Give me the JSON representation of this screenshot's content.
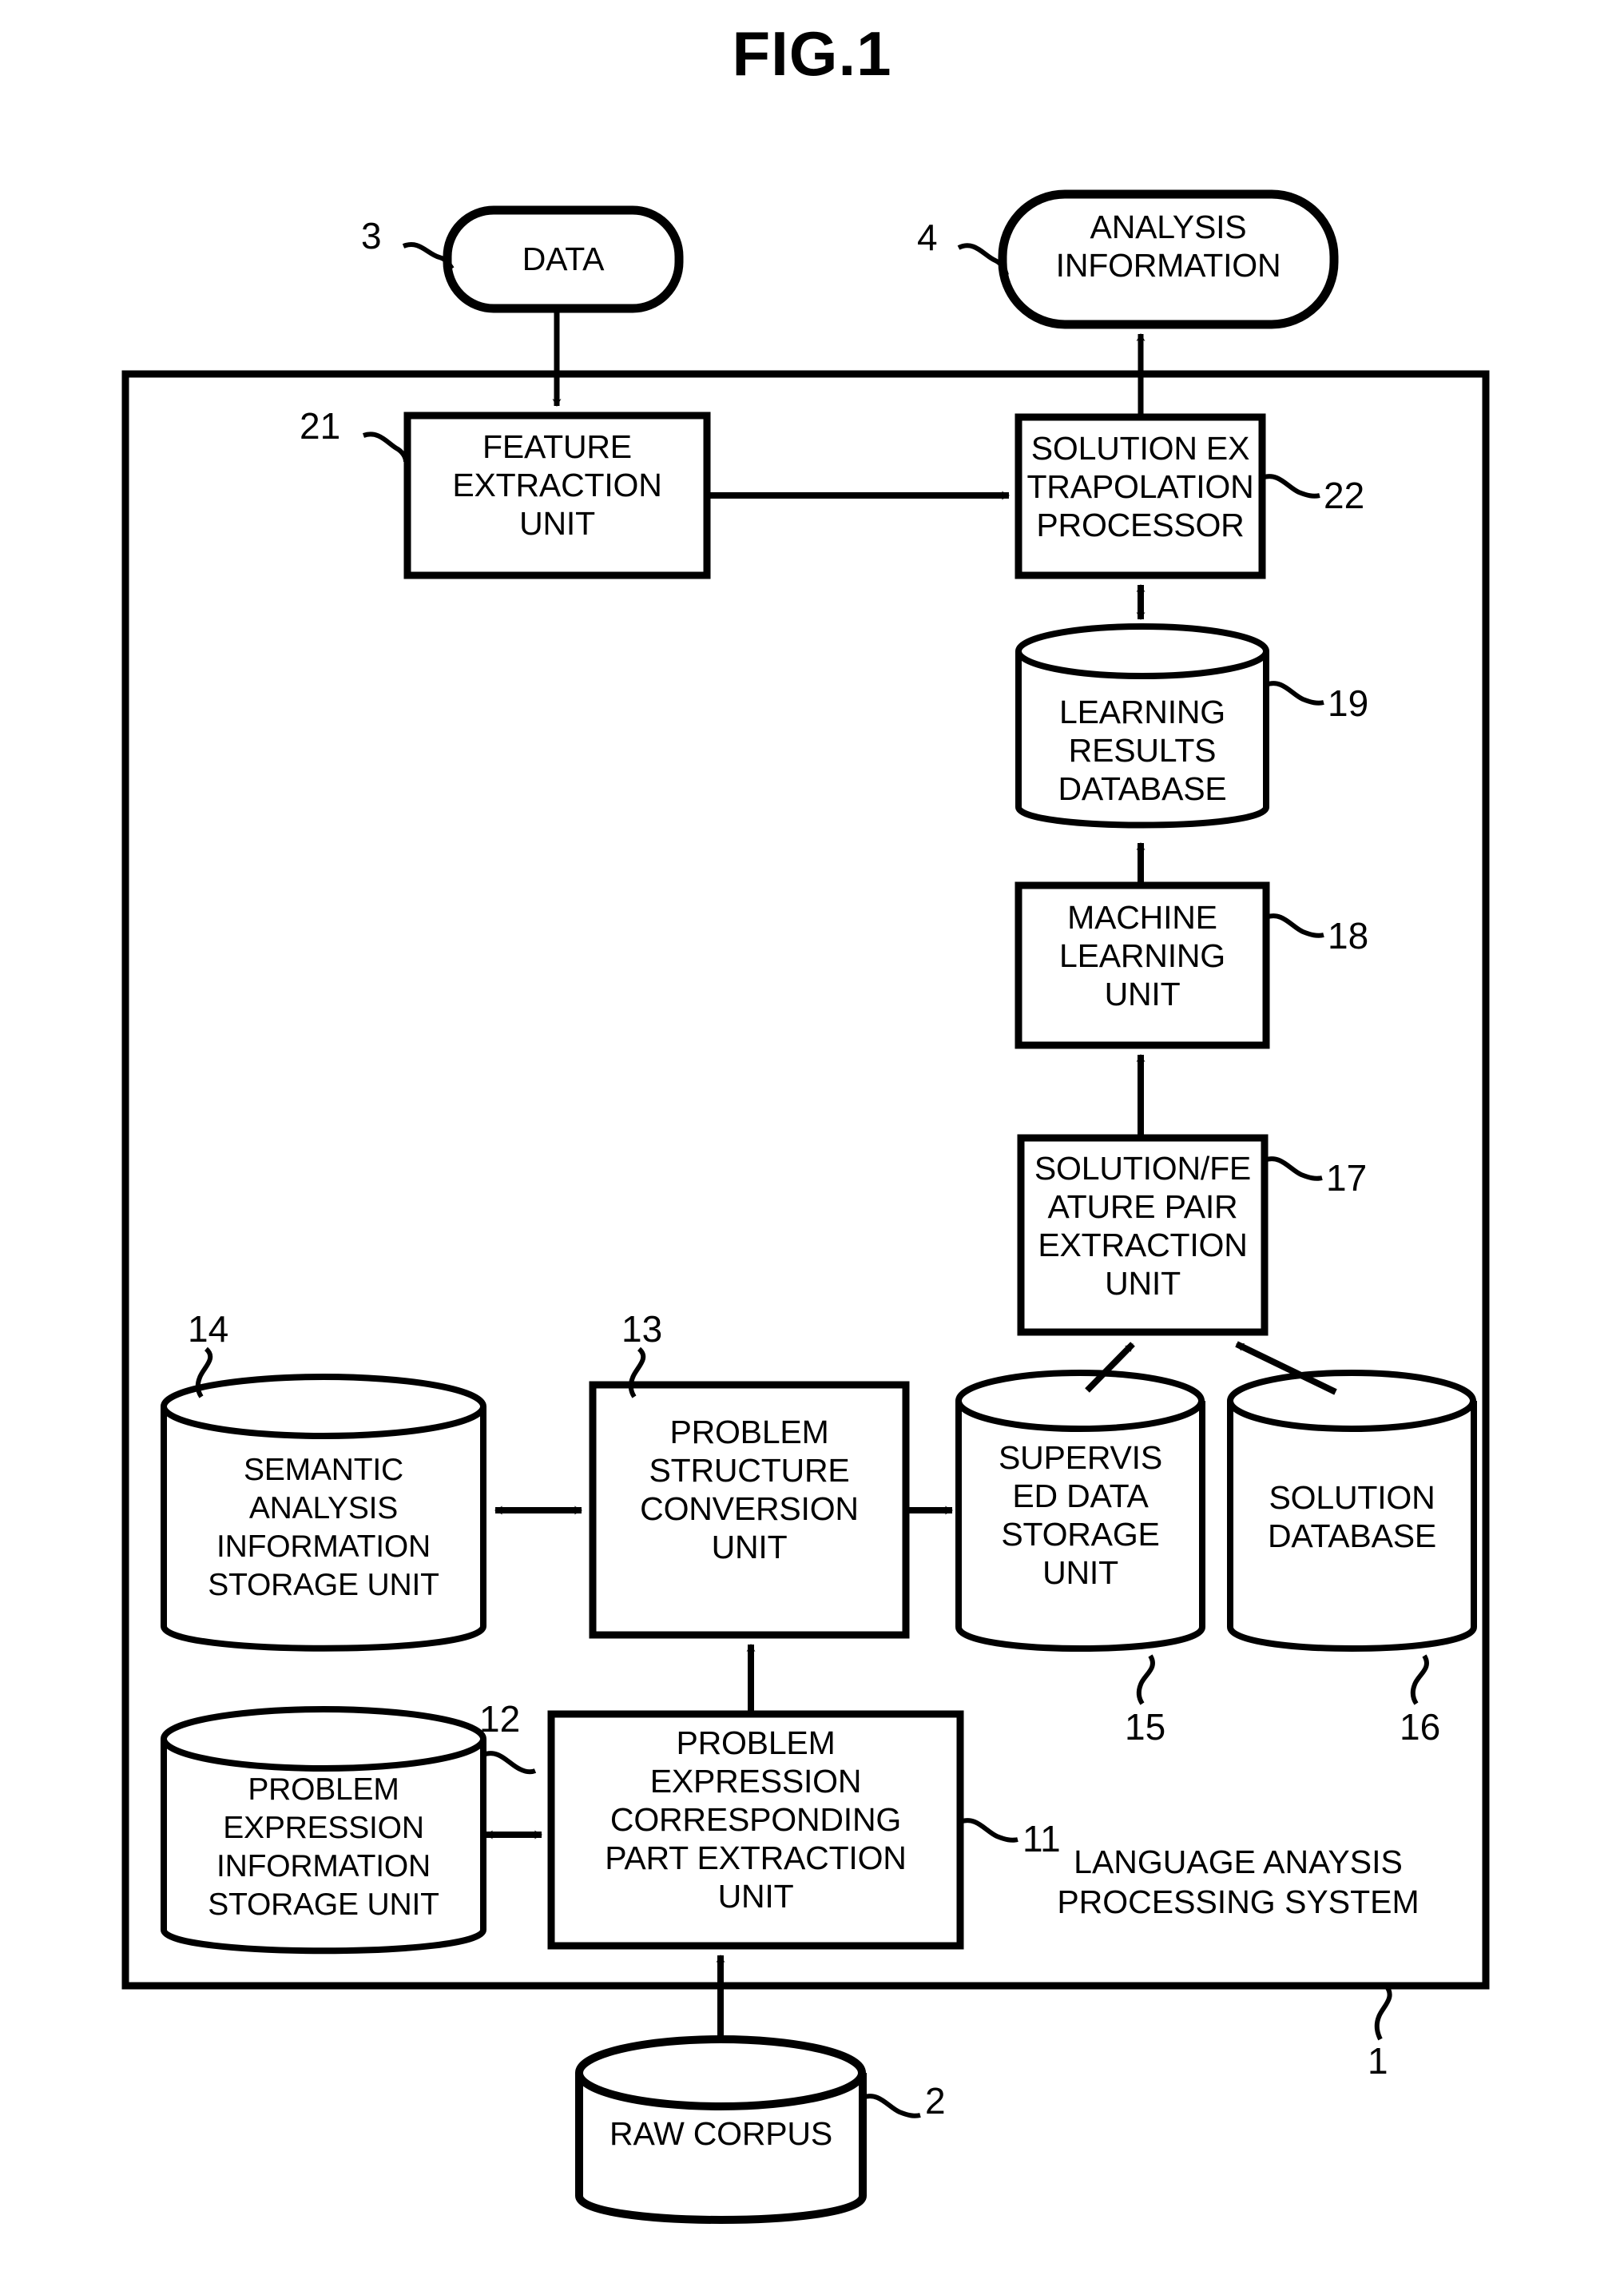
{
  "figure": {
    "title": "FIG.1",
    "system_label": "LANGUAGE ANAYSIS\nPROCESSING SYSTEM",
    "system_ref": "1"
  },
  "external_nodes": [
    {
      "id": "data",
      "shape": "rounded",
      "label": "DATA",
      "ref": "3"
    },
    {
      "id": "analysis_information",
      "shape": "rounded",
      "label": "ANALYSIS\nINFORMATION",
      "ref": "4"
    },
    {
      "id": "raw_corpus",
      "shape": "cylinder",
      "label": "RAW CORPUS",
      "ref": "2"
    }
  ],
  "process_boxes": [
    {
      "id": "feature_extraction_unit",
      "label": "FEATURE\nEXTRACTION\nUNIT",
      "ref": "21"
    },
    {
      "id": "solution_extrapolation_processor",
      "label": "SOLUTION EX\nTRAPOLATION\nPROCESSOR",
      "ref": "22"
    },
    {
      "id": "machine_learning_unit",
      "label": "MACHINE\nLEARNING\nUNIT",
      "ref": "18"
    },
    {
      "id": "solution_feature_pair_extraction_unit",
      "label": "SOLUTION/FE\nATURE PAIR\nEXTRACTION\nUNIT",
      "ref": "17"
    },
    {
      "id": "problem_structure_conversion_unit",
      "label": "PROBLEM\nSTRUCTURE\nCONVERSION\nUNIT",
      "ref": "13"
    },
    {
      "id": "problem_expression_corresponding_part_extraction_unit",
      "label": "PROBLEM\nEXPRESSION\nCORRESPONDING\nPART EXTRACTION\nUNIT",
      "ref": "11"
    }
  ],
  "storage_cylinders": [
    {
      "id": "learning_results_database",
      "label": "LEARNING\nRESULTS\nDATABASE",
      "ref": "19"
    },
    {
      "id": "semantic_analysis_information_storage_unit",
      "label": "SEMANTIC\nANALYSIS\nINFORMATION\nSTORAGE UNIT",
      "ref": "14"
    },
    {
      "id": "supervised_data_storage_unit",
      "label": "SUPERVIS\nED DATA\nSTORAGE\nUNIT",
      "ref": "15"
    },
    {
      "id": "solution_database",
      "label": "SOLUTION\nDATABASE",
      "ref": "16"
    },
    {
      "id": "problem_expression_information_storage_unit",
      "label": "PROBLEM\nEXPRESSION\nINFORMATION\nSTORAGE UNIT",
      "ref": "12"
    }
  ],
  "connections": [
    {
      "from": "data",
      "to": "feature_extraction_unit",
      "kind": "arrow"
    },
    {
      "from": "feature_extraction_unit",
      "to": "solution_extrapolation_processor",
      "kind": "arrow"
    },
    {
      "from": "solution_extrapolation_processor",
      "to": "analysis_information",
      "kind": "arrow"
    },
    {
      "from": "solution_extrapolation_processor",
      "to": "learning_results_database",
      "kind": "double-arrow"
    },
    {
      "from": "machine_learning_unit",
      "to": "learning_results_database",
      "kind": "arrow"
    },
    {
      "from": "solution_feature_pair_extraction_unit",
      "to": "machine_learning_unit",
      "kind": "arrow"
    },
    {
      "from": "supervised_data_storage_unit",
      "to": "solution_feature_pair_extraction_unit",
      "kind": "arrow"
    },
    {
      "from": "solution_database",
      "to": "solution_feature_pair_extraction_unit",
      "kind": "arrow"
    },
    {
      "from": "semantic_analysis_information_storage_unit",
      "to": "problem_structure_conversion_unit",
      "kind": "double-arrow"
    },
    {
      "from": "problem_structure_conversion_unit",
      "to": "supervised_data_storage_unit",
      "kind": "arrow"
    },
    {
      "from": "problem_expression_corresponding_part_extraction_unit",
      "to": "problem_structure_conversion_unit",
      "kind": "arrow"
    },
    {
      "from": "problem_expression_information_storage_unit",
      "to": "problem_expression_corresponding_part_extraction_unit",
      "kind": "double-arrow"
    },
    {
      "from": "raw_corpus",
      "to": "problem_expression_corresponding_part_extraction_unit",
      "kind": "arrow"
    }
  ],
  "style": {
    "stroke": "#000000",
    "background": "#ffffff"
  }
}
